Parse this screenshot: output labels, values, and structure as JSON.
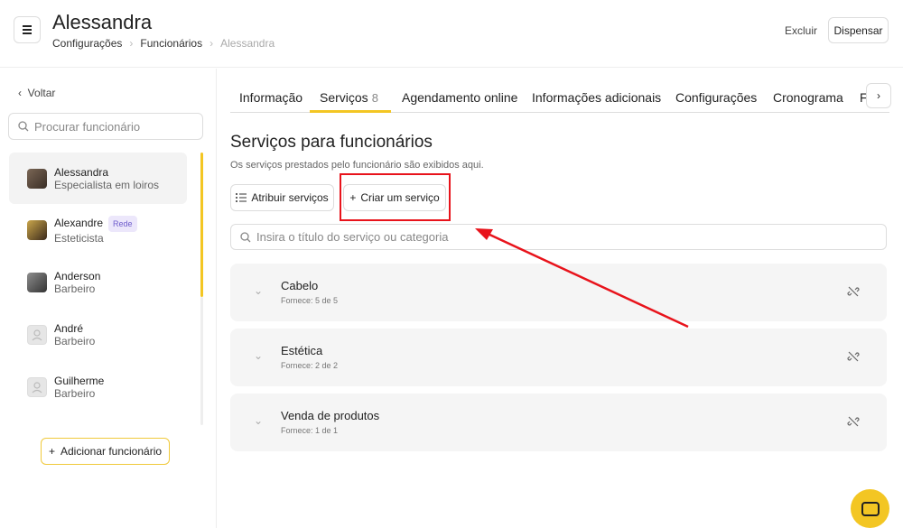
{
  "header": {
    "title": "Alessandra",
    "breadcrumb": [
      "Configurações",
      "Funcionários",
      "Alessandra"
    ],
    "excluir": "Excluir",
    "dispensar": "Dispensar"
  },
  "sidebar": {
    "back": "Voltar",
    "search_placeholder": "Procurar funcionário",
    "employees": [
      {
        "name": "Alessandra",
        "role": "Especialista em loiros",
        "badge": ""
      },
      {
        "name": "Alexandre",
        "role": "Esteticista",
        "badge": "Rede"
      },
      {
        "name": "Anderson",
        "role": "Barbeiro",
        "badge": ""
      },
      {
        "name": "André",
        "role": "Barbeiro",
        "badge": ""
      },
      {
        "name": "Guilherme",
        "role": "Barbeiro",
        "badge": ""
      }
    ],
    "add_button": "Adicionar funcionário"
  },
  "tabs": [
    {
      "label": "Informação"
    },
    {
      "label": "Serviços",
      "count": "8"
    },
    {
      "label": "Agendamento online"
    },
    {
      "label": "Informações adicionais"
    },
    {
      "label": "Configurações"
    },
    {
      "label": "Cronograma"
    },
    {
      "label": "F"
    }
  ],
  "main": {
    "heading": "Serviços para funcionários",
    "subtitle": "Os serviços prestados pelo funcionário são exibidos aqui.",
    "assign_button": "Atribuir serviços",
    "create_button": "Criar um serviço",
    "search_placeholder": "Insira o título do serviço ou categoria",
    "categories": [
      {
        "name": "Cabelo",
        "provides": "Fornece: 5 de 5"
      },
      {
        "name": "Estética",
        "provides": "Fornece: 2 de 2"
      },
      {
        "name": "Venda de produtos",
        "provides": "Fornece: 1 de 1"
      }
    ]
  },
  "colors": {
    "accent": "#f3c623",
    "highlight": "#e8131b"
  }
}
